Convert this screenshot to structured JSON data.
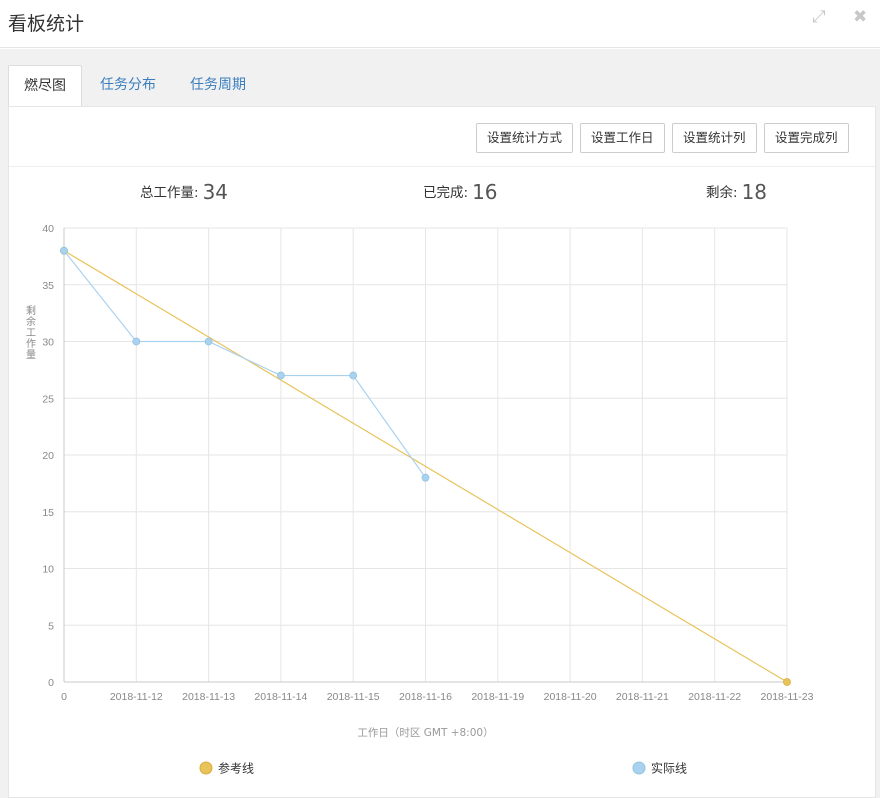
{
  "window": {
    "title": "看板统计",
    "expand_icon": "expand-icon",
    "close_icon": "close-icon"
  },
  "tabs": [
    {
      "label": "燃尽图",
      "active": true
    },
    {
      "label": "任务分布",
      "active": false
    },
    {
      "label": "任务周期",
      "active": false
    }
  ],
  "toolbar": {
    "buttons": [
      {
        "label": "设置统计方式"
      },
      {
        "label": "设置工作日"
      },
      {
        "label": "设置统计列"
      },
      {
        "label": "设置完成列"
      }
    ]
  },
  "stats": {
    "total_label": "总工作量:",
    "total_value": "34",
    "done_label": "已完成:",
    "done_value": "16",
    "remaining_label": "剩余:",
    "remaining_value": "18"
  },
  "chart_data": {
    "type": "line",
    "categories": [
      "0",
      "2018-11-12",
      "2018-11-13",
      "2018-11-14",
      "2018-11-15",
      "2018-11-16",
      "2018-11-19",
      "2018-11-20",
      "2018-11-21",
      "2018-11-22",
      "2018-11-23"
    ],
    "series": [
      {
        "name": "参考线",
        "color": "#e8c35a",
        "values": [
          38,
          null,
          null,
          null,
          null,
          null,
          null,
          null,
          null,
          null,
          0
        ]
      },
      {
        "name": "实际线",
        "color": "#a9d2ef",
        "values": [
          38,
          30,
          30,
          27,
          27,
          18,
          null,
          null,
          null,
          null,
          null
        ]
      }
    ],
    "xlabel": "工作日（时区 GMT +8:00）",
    "ylabel": "剩余工作量",
    "ylim": [
      0,
      40
    ],
    "yticks": [
      0,
      5,
      10,
      15,
      20,
      25,
      30,
      35,
      40
    ],
    "grid": true,
    "legend_position": "bottom"
  }
}
